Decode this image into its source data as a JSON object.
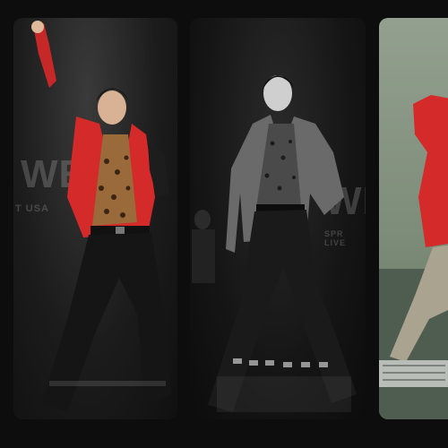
{
  "panels": [
    {
      "bg_text": "WE",
      "bg_subtext": "T USA"
    },
    {
      "bg_text": "WE",
      "bg_subtext": "SPR LIVE"
    },
    {
      "bg_text": "",
      "bg_subtext": ""
    }
  ],
  "colors": {
    "jacket_red": "#d42a2a",
    "leopard": "#9a6a3a",
    "stage_dark": "#101010",
    "panel3_bg": "#8a9886"
  }
}
